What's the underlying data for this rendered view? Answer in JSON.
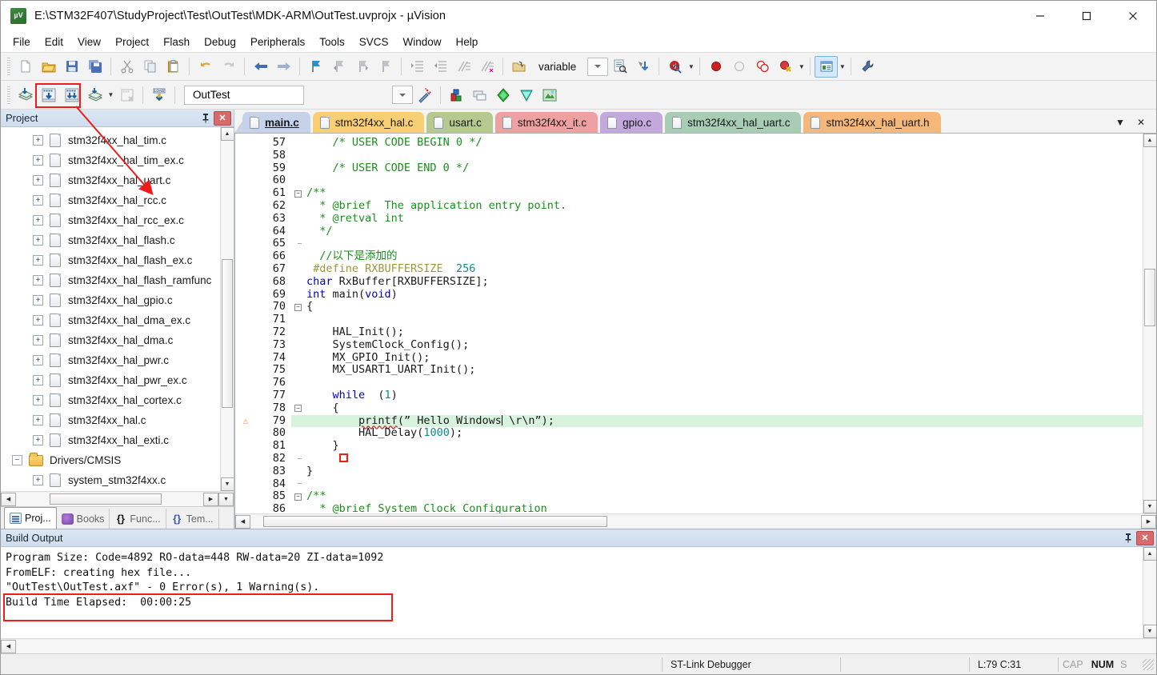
{
  "window": {
    "title": "E:\\STM32F407\\StudyProject\\Test\\OutTest\\MDK-ARM\\OutTest.uvprojx - µVision",
    "app_icon_text": "µV",
    "minimize": "—",
    "maximize": "☐",
    "close": "✕"
  },
  "menubar": {
    "items": [
      {
        "label": "File"
      },
      {
        "label": "Edit"
      },
      {
        "label": "View"
      },
      {
        "label": "Project"
      },
      {
        "label": "Flash"
      },
      {
        "label": "Debug"
      },
      {
        "label": "Peripherals"
      },
      {
        "label": "Tools"
      },
      {
        "label": "SVCS"
      },
      {
        "label": "Window"
      },
      {
        "label": "Help"
      }
    ]
  },
  "toolbar1": {
    "icons": [
      "new-file-icon",
      "open-file-icon",
      "save-icon",
      "save-all-icon",
      "cut-icon",
      "copy-icon",
      "paste-icon",
      "undo-icon",
      "redo-icon",
      "navigate-back-icon",
      "navigate-forward-icon",
      "bookmark-toggle-icon",
      "bookmark-prev-icon",
      "bookmark-next-icon",
      "bookmark-clear-icon",
      "indent-icon",
      "outdent-icon",
      "comment-icon",
      "uncomment-icon",
      "browse-variable-icon"
    ],
    "variable_field": "variable",
    "dropdown_icon": "chevron-down-icon",
    "find-in-files-icon": "find-in-files-icon",
    "insert-icon": "insert-icon",
    "debug-query-icon": "debug-query-icon",
    "breakpoint-icon": "breakpoint-icon",
    "breakpoint-disable-icon": "breakpoint-disable-icon",
    "breakpoint-all-icon": "breakpoint-all-icon",
    "breakpoint-kill-icon": "breakpoint-kill-icon",
    "window-layout-icon": "window-layout-icon",
    "config-wizard-icon": "configuration-wizard-icon"
  },
  "toolbar2": {
    "translate_icon": "translate-icon",
    "build_icon": "build-icon",
    "rebuild_icon": "rebuild-all-icon",
    "batch_build_icon": "batch-build-icon",
    "stop_build_icon": "stop-build-icon",
    "download_icon": "download-load-icon",
    "target_name": "OutTest",
    "target_dropdown_icon": "chevron-down-icon",
    "magic_wand_icon": "target-options-magic-wand-icon",
    "manage_project_icon": "manage-project-items-icon",
    "multi_project_icon": "multi-project-icon",
    "pack_installer_icon": "pack-installer-icon",
    "run_time_env_icon": "manage-run-time-environment-icon",
    "svcs_icon": "svcs-icon"
  },
  "project_panel": {
    "caption": "Project",
    "pin_icon": "pin-icon",
    "close_icon": "close-icon",
    "tree": [
      {
        "label": "stm32f4xx_hal_tim.c",
        "type": "file",
        "indent": 1
      },
      {
        "label": "stm32f4xx_hal_tim_ex.c",
        "type": "file",
        "indent": 1
      },
      {
        "label": "stm32f4xx_hal_uart.c",
        "type": "file",
        "indent": 1
      },
      {
        "label": "stm32f4xx_hal_rcc.c",
        "type": "file",
        "indent": 1
      },
      {
        "label": "stm32f4xx_hal_rcc_ex.c",
        "type": "file",
        "indent": 1
      },
      {
        "label": "stm32f4xx_hal_flash.c",
        "type": "file",
        "indent": 1
      },
      {
        "label": "stm32f4xx_hal_flash_ex.c",
        "type": "file",
        "indent": 1
      },
      {
        "label": "stm32f4xx_hal_flash_ramfunc",
        "type": "file",
        "indent": 1
      },
      {
        "label": "stm32f4xx_hal_gpio.c",
        "type": "file",
        "indent": 1
      },
      {
        "label": "stm32f4xx_hal_dma_ex.c",
        "type": "file",
        "indent": 1
      },
      {
        "label": "stm32f4xx_hal_dma.c",
        "type": "file",
        "indent": 1
      },
      {
        "label": "stm32f4xx_hal_pwr.c",
        "type": "file",
        "indent": 1
      },
      {
        "label": "stm32f4xx_hal_pwr_ex.c",
        "type": "file",
        "indent": 1
      },
      {
        "label": "stm32f4xx_hal_cortex.c",
        "type": "file",
        "indent": 1
      },
      {
        "label": "stm32f4xx_hal.c",
        "type": "file",
        "indent": 1
      },
      {
        "label": "stm32f4xx_hal_exti.c",
        "type": "file",
        "indent": 1
      },
      {
        "label": "Drivers/CMSIS",
        "type": "folder",
        "indent": 0
      },
      {
        "label": "system_stm32f4xx.c",
        "type": "file",
        "indent": 1
      }
    ],
    "tabs": [
      {
        "label": "Proj...",
        "icon": "project-icon",
        "selected": true
      },
      {
        "label": "Books",
        "icon": "books-icon",
        "selected": false
      },
      {
        "label": "Func...",
        "icon": "functions-icon",
        "selected": false
      },
      {
        "label": "Tem...",
        "icon": "templates-icon",
        "selected": false
      }
    ]
  },
  "editor": {
    "tabs": [
      {
        "label": "main.c",
        "color": "#c5d2ea",
        "active": true
      },
      {
        "label": "stm32f4xx_hal.c",
        "color": "#f8cf72",
        "active": false
      },
      {
        "label": "usart.c",
        "color": "#b6c98f",
        "active": false
      },
      {
        "label": "stm32f4xx_it.c",
        "color": "#efa1a1",
        "active": false
      },
      {
        "label": "gpio.c",
        "color": "#c3a8de",
        "active": false
      },
      {
        "label": "stm32f4xx_hal_uart.c",
        "color": "#a8ccb4",
        "active": false
      },
      {
        "label": "stm32f4xx_hal_uart.h",
        "color": "#f5b87a",
        "active": false
      }
    ],
    "tab_dropdown_icon": "chevron-down-icon",
    "tab_close_icon": "close-icon",
    "lines": [
      {
        "n": 57,
        "fold": "",
        "warn": false,
        "hl": false,
        "segs": [
          {
            "t": "    /* USER CODE BEGIN 0 */",
            "c": "cm"
          }
        ]
      },
      {
        "n": 58,
        "fold": "",
        "warn": false,
        "hl": false,
        "segs": [
          {
            "t": "",
            "c": "pl"
          }
        ]
      },
      {
        "n": 59,
        "fold": "",
        "warn": false,
        "hl": false,
        "segs": [
          {
            "t": "    /* USER CODE END 0 */",
            "c": "cm"
          }
        ]
      },
      {
        "n": 60,
        "fold": "",
        "warn": false,
        "hl": false,
        "segs": [
          {
            "t": "",
            "c": "pl"
          }
        ]
      },
      {
        "n": 61,
        "fold": "minus",
        "warn": false,
        "hl": false,
        "segs": [
          {
            "t": "/**",
            "c": "cm"
          }
        ]
      },
      {
        "n": 62,
        "fold": "bar",
        "warn": false,
        "hl": false,
        "segs": [
          {
            "t": "  * @brief  The application entry point.",
            "c": "cm"
          }
        ]
      },
      {
        "n": 63,
        "fold": "bar",
        "warn": false,
        "hl": false,
        "segs": [
          {
            "t": "  * @retval int",
            "c": "cm"
          }
        ]
      },
      {
        "n": 64,
        "fold": "bar",
        "warn": false,
        "hl": false,
        "segs": [
          {
            "t": "  */",
            "c": "cm"
          }
        ]
      },
      {
        "n": 65,
        "fold": "end",
        "warn": false,
        "hl": false,
        "segs": [
          {
            "t": "",
            "c": "pl"
          }
        ]
      },
      {
        "n": 66,
        "fold": "",
        "warn": false,
        "hl": false,
        "segs": [
          {
            "t": "  //以下是添加的",
            "c": "cm"
          }
        ]
      },
      {
        "n": 67,
        "fold": "",
        "warn": false,
        "hl": false,
        "segs": [
          {
            "t": " #define RXBUFFERSIZE  ",
            "c": "pp"
          },
          {
            "t": "256",
            "c": "num"
          }
        ]
      },
      {
        "n": 68,
        "fold": "",
        "warn": false,
        "hl": false,
        "segs": [
          {
            "t": "char",
            "c": "kw"
          },
          {
            "t": " RxBuffer[RXBUFFERSIZE];",
            "c": "pl"
          }
        ]
      },
      {
        "n": 69,
        "fold": "",
        "warn": false,
        "hl": false,
        "segs": [
          {
            "t": "int",
            "c": "kw"
          },
          {
            "t": " main(",
            "c": "pl"
          },
          {
            "t": "void",
            "c": "kw"
          },
          {
            "t": ")",
            "c": "pl"
          }
        ]
      },
      {
        "n": 70,
        "fold": "minus",
        "warn": false,
        "hl": false,
        "segs": [
          {
            "t": "{",
            "c": "pl"
          }
        ]
      },
      {
        "n": 71,
        "fold": "bar",
        "warn": false,
        "hl": false,
        "segs": [
          {
            "t": "",
            "c": "pl"
          }
        ]
      },
      {
        "n": 72,
        "fold": "bar",
        "warn": false,
        "hl": false,
        "segs": [
          {
            "t": "    HAL_Init();",
            "c": "pl"
          }
        ]
      },
      {
        "n": 73,
        "fold": "bar",
        "warn": false,
        "hl": false,
        "segs": [
          {
            "t": "    SystemClock_Config();",
            "c": "pl"
          }
        ]
      },
      {
        "n": 74,
        "fold": "bar",
        "warn": false,
        "hl": false,
        "segs": [
          {
            "t": "    MX_GPIO_Init();",
            "c": "pl"
          }
        ]
      },
      {
        "n": 75,
        "fold": "bar",
        "warn": false,
        "hl": false,
        "segs": [
          {
            "t": "    MX_USART1_UART_Init();",
            "c": "pl"
          }
        ]
      },
      {
        "n": 76,
        "fold": "bar",
        "warn": false,
        "hl": false,
        "segs": [
          {
            "t": "",
            "c": "pl"
          }
        ]
      },
      {
        "n": 77,
        "fold": "bar",
        "warn": false,
        "hl": false,
        "segs": [
          {
            "t": "    ",
            "c": "pl"
          },
          {
            "t": "while",
            "c": "kw"
          },
          {
            "t": "  (",
            "c": "pl"
          },
          {
            "t": "1",
            "c": "num"
          },
          {
            "t": ")",
            "c": "pl"
          }
        ]
      },
      {
        "n": 78,
        "fold": "minus2",
        "warn": false,
        "hl": false,
        "segs": [
          {
            "t": "    {",
            "c": "pl"
          }
        ]
      },
      {
        "n": 79,
        "fold": "bar2",
        "warn": true,
        "hl": true,
        "segs": [
          {
            "t": "        ",
            "c": "pl"
          },
          {
            "t": "printf",
            "c": "sq"
          },
          {
            "t": "(” Hello Windows",
            "c": "pl"
          },
          {
            "t": "|",
            "c": "caret"
          },
          {
            "t": " \\r\\n”);",
            "c": "pl"
          }
        ]
      },
      {
        "n": 80,
        "fold": "bar2",
        "warn": false,
        "hl": false,
        "segs": [
          {
            "t": "        HAL_Delay(",
            "c": "pl"
          },
          {
            "t": "1000",
            "c": "num"
          },
          {
            "t": ");",
            "c": "pl"
          }
        ]
      },
      {
        "n": 81,
        "fold": "bar2",
        "warn": false,
        "hl": false,
        "segs": [
          {
            "t": "    }",
            "c": "pl"
          }
        ]
      },
      {
        "n": 82,
        "fold": "end2",
        "warn": false,
        "hl": false,
        "segs": [
          {
            "t": "     ",
            "c": "pl"
          },
          {
            "t": "□",
            "c": "redsq"
          }
        ]
      },
      {
        "n": 83,
        "fold": "bar",
        "warn": false,
        "hl": false,
        "segs": [
          {
            "t": "}",
            "c": "pl"
          }
        ]
      },
      {
        "n": 84,
        "fold": "end",
        "warn": false,
        "hl": false,
        "segs": [
          {
            "t": "",
            "c": "pl"
          }
        ]
      },
      {
        "n": 85,
        "fold": "minus",
        "warn": false,
        "hl": false,
        "segs": [
          {
            "t": "/**",
            "c": "cm"
          }
        ]
      },
      {
        "n": 86,
        "fold": "bar",
        "warn": false,
        "hl": false,
        "segs": [
          {
            "t": "  * @brief System Clock Configuration",
            "c": "cm"
          }
        ]
      }
    ]
  },
  "build_output": {
    "caption": "Build Output",
    "pin_icon": "pin-icon",
    "close_icon": "close-icon",
    "lines": [
      "Program Size: Code=4892 RO-data=448 RW-data=20 ZI-data=1092",
      "FromELF: creating hex file...",
      "\"OutTest\\OutTest.axf\" - 0 Error(s), 1 Warning(s).",
      "Build Time Elapsed:  00:00:25"
    ]
  },
  "statusbar": {
    "debugger": "ST-Link Debugger",
    "position": "L:79 C:31",
    "cap": "CAP",
    "num": "NUM",
    "scrl": "S"
  },
  "colors": {
    "accent_red": "#ef1c1c",
    "title_bg": "#ffffff",
    "panel_caption": "#d5e2f0",
    "highlight_line": "#d8f3dd",
    "comment_green": "#1a8f1a",
    "keyword_blue": "#0000c8"
  }
}
